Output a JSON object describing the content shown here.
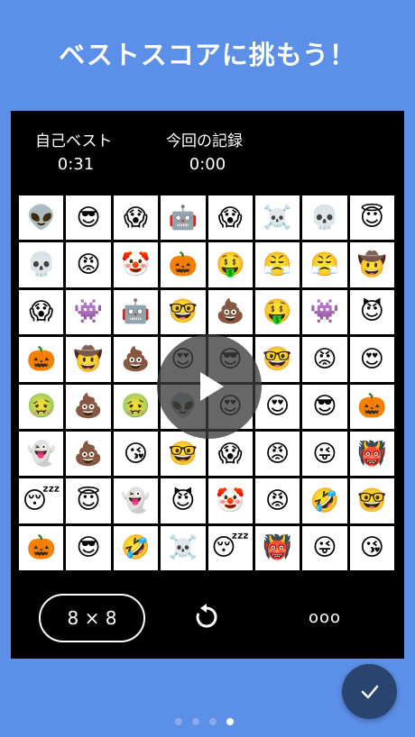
{
  "headline": "ベストスコアに挑もう！",
  "stats": {
    "best_label": "自己ベスト",
    "best_value": "0:31",
    "record_label": "今回の記録",
    "record_value": "0:00"
  },
  "grid": [
    [
      "👽",
      "😎",
      "😱",
      "🤖",
      "😱",
      "☠️",
      "💀",
      "😇"
    ],
    [
      "💀",
      "😡",
      "🤡",
      "🎃",
      "🤑",
      "😤",
      "😤",
      "🤠"
    ],
    [
      "😱",
      "👾",
      "🤖",
      "🤓",
      "💩",
      "🤑",
      "👾",
      "😈"
    ],
    [
      "🎃",
      "🤠",
      "💩",
      "😍",
      "😎",
      "🤓",
      "😡",
      "😍"
    ],
    [
      "🤢",
      "💩",
      "🤢",
      "👽",
      "😍",
      "😍",
      "😎",
      "🎃"
    ],
    [
      "👻",
      "💩",
      "😘",
      "🤓",
      "😱",
      "😡",
      "😜",
      "👹"
    ],
    [
      "😴",
      "😇",
      "👻",
      "😈",
      "🤡",
      "😡",
      "🤣",
      "🤓"
    ],
    [
      "🎃",
      "😎",
      "🤣",
      "☠️",
      "😴",
      "👹",
      "😜",
      "😘"
    ]
  ],
  "controls": {
    "size_label": "8 × 8",
    "reset_icon": "reset-icon",
    "more_label": "ooo",
    "play_icon": "play-icon",
    "confirm_icon": "checkmark-icon"
  },
  "pager": {
    "count": 4,
    "active": 3
  },
  "colors": {
    "background": "#5b8fe8",
    "panel": "#000000",
    "fab": "#2a4470"
  }
}
